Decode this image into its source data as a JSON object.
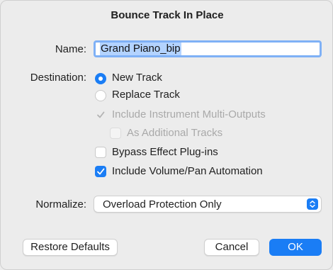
{
  "dialog": {
    "title": "Bounce Track In Place"
  },
  "name": {
    "label": "Name:",
    "value": "Grand Piano_bip"
  },
  "destination": {
    "label": "Destination:",
    "options": [
      {
        "label": "New Track",
        "selected": true
      },
      {
        "label": "Replace Track",
        "selected": false
      }
    ]
  },
  "checkboxes": {
    "multi_outputs": {
      "label": "Include Instrument Multi-Outputs",
      "checked": true,
      "enabled": false
    },
    "additional_tracks": {
      "label": "As Additional Tracks",
      "checked": false,
      "enabled": false
    },
    "bypass_effects": {
      "label": "Bypass Effect Plug-ins",
      "checked": false,
      "enabled": true
    },
    "volume_pan": {
      "label": "Include Volume/Pan Automation",
      "checked": true,
      "enabled": true
    }
  },
  "normalize": {
    "label": "Normalize:",
    "selected": "Overload Protection Only",
    "icon": "up-down-chevron-icon"
  },
  "buttons": {
    "restore_defaults": "Restore Defaults",
    "cancel": "Cancel",
    "ok": "OK"
  },
  "colors": {
    "accent": "#1a7df5",
    "background": "#ececec",
    "disabled_text": "#a9a9a9",
    "selection_highlight": "#b3d3ff"
  }
}
